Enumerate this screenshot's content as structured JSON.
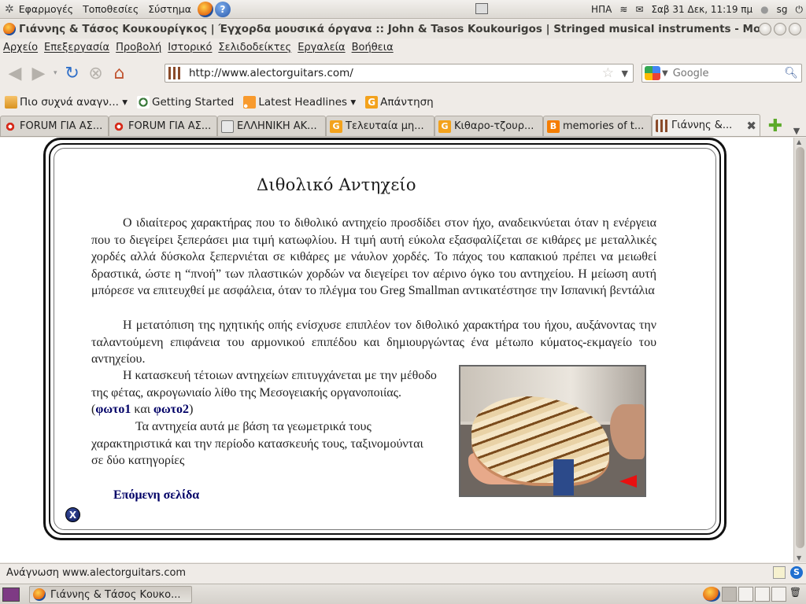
{
  "top_panel": {
    "menus": [
      "Εφαρμογές",
      "Τοποθεσίες",
      "Σύστημα"
    ],
    "keyboard_layout": "ΗΠΑ",
    "clock": "Σαβ 31 Δεκ, 11:19 πμ",
    "user": "sg"
  },
  "window": {
    "title": "Γιάννης & Τάσος Κουκουρίγκος | Έγχορδα μουσικά όργανα :: John & Tasos Koukourigos | Stringed musical instruments - Moz"
  },
  "menubar": [
    "Αρχείο",
    "Επεξεργασία",
    "Προβολή",
    "Ιστορικό",
    "Σελιδοδείκτες",
    "Εργαλεία",
    "Βοήθεια"
  ],
  "navbar": {
    "url": "http://www.alectorguitars.com/",
    "search_placeholder": "Google"
  },
  "bookmarks": [
    {
      "label": "Πιο συχνά αναγν... ▾",
      "icon": "folder-icon"
    },
    {
      "label": "Getting Started",
      "icon": "getting-started-icon"
    },
    {
      "label": "Latest Headlines ▾",
      "icon": "rss-icon"
    },
    {
      "label": "Απάντηση",
      "icon": "g-icon"
    }
  ],
  "tabs": [
    {
      "label": "FORUM ΓΙΑ ΑΣ...",
      "icon": "sun-icon"
    },
    {
      "label": "FORUM ΓΙΑ ΑΣ...",
      "icon": "sun-icon"
    },
    {
      "label": "ΕΛΛΗΝΙΚΗ ΑΚ...",
      "icon": "eak-icon"
    },
    {
      "label": "Τελευταία μη...",
      "icon": "g-icon"
    },
    {
      "label": "Κιθαρο-τζουρ...",
      "icon": "g-icon"
    },
    {
      "label": "memories of t...",
      "icon": "blogger-icon"
    },
    {
      "label": "Γιάννης &...",
      "icon": "guitar-icon",
      "active": true
    }
  ],
  "page": {
    "title": "Διθολικό Αντηχείο",
    "para1": "Ο ιδιαίτερος χαρακτήρας που το διθολικό αντηχείο προσδίδει στον ήχο, αναδεικνύεται όταν η ενέργεια που το διεγείρει ξεπεράσει μια τιμή κατωφλίου. Η τιμή αυτή εύκολα εξασφαλίζεται σε κιθάρες με μεταλλικές χορδές αλλά δύσκολα ξεπερνιέται σε κιθάρες με νάυλον χορδές. Το πάχος του καπακιού πρέπει να μειωθεί δραστικά, ώστε η “πνοή” των πλαστικών χορδών να διεγείρει τον αέρινο όγκο του αντηχείου. Η μείωση αυτή μπόρεσε να επιτευχθεί με ασφάλεια, όταν το πλέγμα του Greg Smallman αντικατέστησε την Ισπανική βεντάλια",
    "para2": "Η μετατόπιση της ηχητικής οπής ενίσχυσε επιπλέον τον διθολικό χαρακτήρα του ήχου, αυξάνοντας την ταλαντούμενη επιφάνεια του αρμονικού επιπέδου και δημιουργώντας ένα μέτωπο κύματος-εκμαγείο του αντηχείου.",
    "para3_start": "Η κατασκευή τέτοιων αντηχείων επιτυγχάνεται με την μέθοδο της φέτας, ακρογωνιαίο λίθο της Μεσογειακής οργανοποιίας.(",
    "link_photo1": "φωτο1",
    "para3_and": " και ",
    "link_photo2": "φωτο2",
    "para3_end": ")",
    "para4": "Τα αντηχεία αυτά με βάση τα γεωμετρικά τους χαρακτηριστικά και την περίοδο κατασκευής τους, ταξινομούνται σε δύο κατηγορίες",
    "next_page": "Επόμενη σελίδα",
    "close_label": "X"
  },
  "status": {
    "text": "Ανάγνωση www.alectorguitars.com"
  },
  "taskbar": {
    "window_label": "Γιάννης & Τάσος Κουκο..."
  }
}
